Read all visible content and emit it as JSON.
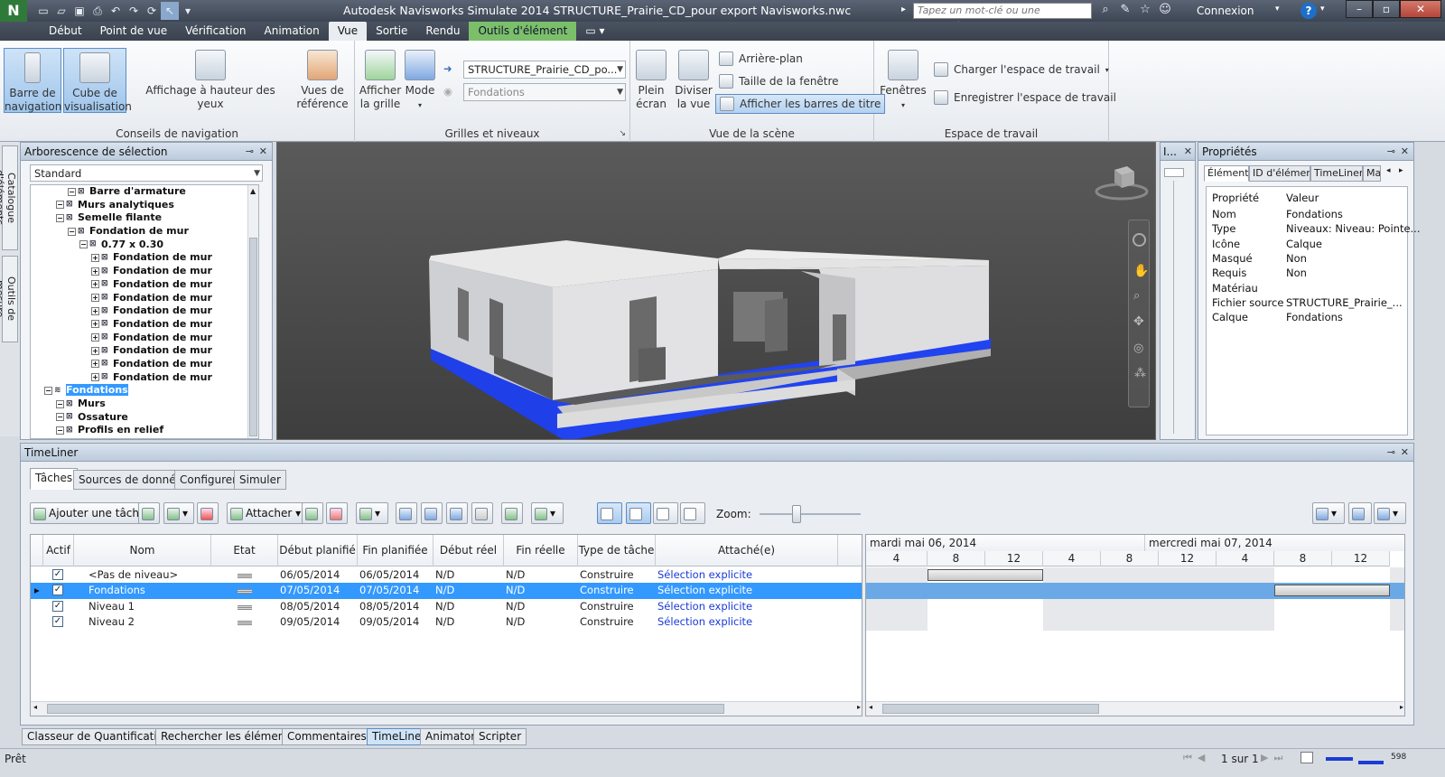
{
  "window": {
    "title": "Autodesk Navisworks Simulate 2014    STRUCTURE_Prairie_CD_pour export Navisworks.nwc",
    "search_placeholder": "Tapez un mot-clé ou une expression",
    "connexion": "Connexion",
    "app_letter": "N"
  },
  "menu_tabs": [
    "Début",
    "Point de vue",
    "Vérification",
    "Animation",
    "Vue",
    "Sortie",
    "Rendu",
    "Outils d'élément"
  ],
  "ribbon": {
    "nav": {
      "barre": "Barre de navigation",
      "cube": "Cube de visualisation",
      "affichage": "Affichage à hauteur des yeux",
      "vues": "Vues de référence",
      "label": "Conseils de navigation"
    },
    "grilles": {
      "afficher": "Afficher la grille",
      "mode": "Mode",
      "combo1": "STRUCTURE_Prairie_CD_po...",
      "combo2": "Fondations",
      "label": "Grilles et niveaux"
    },
    "scene": {
      "plein": "Plein écran",
      "diviser": "Diviser la vue",
      "arriere": "Arrière-plan",
      "taille": "Taille de la fenêtre",
      "barres": "Afficher les barres de titre",
      "label": "Vue de la scène"
    },
    "espace": {
      "fenetres": "Fenêtres",
      "charger": "Charger l'espace de travail",
      "enregistrer": "Enregistrer l'espace de travail",
      "label": "Espace de travail"
    }
  },
  "vtabs": [
    "Catalogue d'éléments",
    "Outils de mesure"
  ],
  "selection_tree": {
    "title": "Arborescence de sélection",
    "mode": "Standard",
    "rows": [
      {
        "label": "Barre d'armature",
        "indent": 3
      },
      {
        "label": "Murs analytiques",
        "indent": 2
      },
      {
        "label": "Semelle filante",
        "indent": 2
      },
      {
        "label": "Fondation de mur",
        "indent": 3
      },
      {
        "label": "0.77 x 0.30",
        "indent": 4
      },
      {
        "label": "Fondation de mur",
        "indent": 5
      },
      {
        "label": "Fondation de mur",
        "indent": 5
      },
      {
        "label": "Fondation de mur",
        "indent": 5
      },
      {
        "label": "Fondation de mur",
        "indent": 5
      },
      {
        "label": "Fondation de mur",
        "indent": 5
      },
      {
        "label": "Fondation de mur",
        "indent": 5
      },
      {
        "label": "Fondation de mur",
        "indent": 5
      },
      {
        "label": "Fondation de mur",
        "indent": 5
      },
      {
        "label": "Fondation de mur",
        "indent": 5
      },
      {
        "label": "Fondation de mur",
        "indent": 5
      },
      {
        "label": "Fondations",
        "indent": 1,
        "selected": true
      },
      {
        "label": "Murs",
        "indent": 2
      },
      {
        "label": "Ossature",
        "indent": 2
      },
      {
        "label": "Profils en relief",
        "indent": 2
      }
    ]
  },
  "mini_panel_title": "I...",
  "properties": {
    "title": "Propriétés",
    "tabs": [
      "Élément",
      "ID d'élément",
      "TimeLiner",
      "Ma"
    ],
    "col_prop": "Propriété",
    "col_val": "Valeur",
    "rows": [
      {
        "k": "Nom",
        "v": "Fondations"
      },
      {
        "k": "Type",
        "v": "Niveaux: Niveau: Pointe..."
      },
      {
        "k": "Icône",
        "v": "Calque"
      },
      {
        "k": "Masqué",
        "v": "Non"
      },
      {
        "k": "Requis",
        "v": "Non"
      },
      {
        "k": "Matériau",
        "v": ""
      },
      {
        "k": "Fichier source",
        "v": "STRUCTURE_Prairie_..."
      },
      {
        "k": "Calque",
        "v": "Fondations"
      }
    ]
  },
  "timeliner": {
    "title": "TimeLiner",
    "tabs": [
      "Tâches",
      "Sources de données",
      "Configurer",
      "Simuler"
    ],
    "add_task": "Ajouter une tâche",
    "attach": "Attacher",
    "zoom": "Zoom:",
    "zoom_level": 0.35,
    "columns": [
      "Actif",
      "Nom",
      "Etat",
      "Début planifié",
      "Fin planifiée",
      "Début réel",
      "Fin réelle",
      "Type de tâche",
      "Attaché(e)"
    ],
    "tasks": [
      {
        "name": "<Pas de niveau>",
        "start": "06/05/2014",
        "end": "06/05/2014",
        "rstart": "N/D",
        "rend": "N/D",
        "type": "Construire",
        "attached": "Sélection explicite"
      },
      {
        "name": "Fondations",
        "start": "07/05/2014",
        "end": "07/05/2014",
        "rstart": "N/D",
        "rend": "N/D",
        "type": "Construire",
        "attached": "Sélection explicite",
        "selected": true
      },
      {
        "name": "Niveau 1",
        "start": "08/05/2014",
        "end": "08/05/2014",
        "rstart": "N/D",
        "rend": "N/D",
        "type": "Construire",
        "attached": "Sélection explicite"
      },
      {
        "name": "Niveau 2",
        "start": "09/05/2014",
        "end": "09/05/2014",
        "rstart": "N/D",
        "rend": "N/D",
        "type": "Construire",
        "attached": "Sélection explicite"
      }
    ],
    "gantt_days": [
      "mardi mai 06, 2014",
      "mercredi mai 07, 2014"
    ],
    "gantt_hours": [
      "4",
      "8",
      "12",
      "4",
      "8",
      "12",
      "4",
      "8",
      "12"
    ]
  },
  "bottom_tabs": [
    "Classeur de Quantification",
    "Rechercher les éléments",
    "Commentaires",
    "TimeLiner",
    "Animator",
    "Scripter"
  ],
  "status": {
    "left": "Prêt",
    "page": "1 sur 1",
    "mem": "598"
  }
}
